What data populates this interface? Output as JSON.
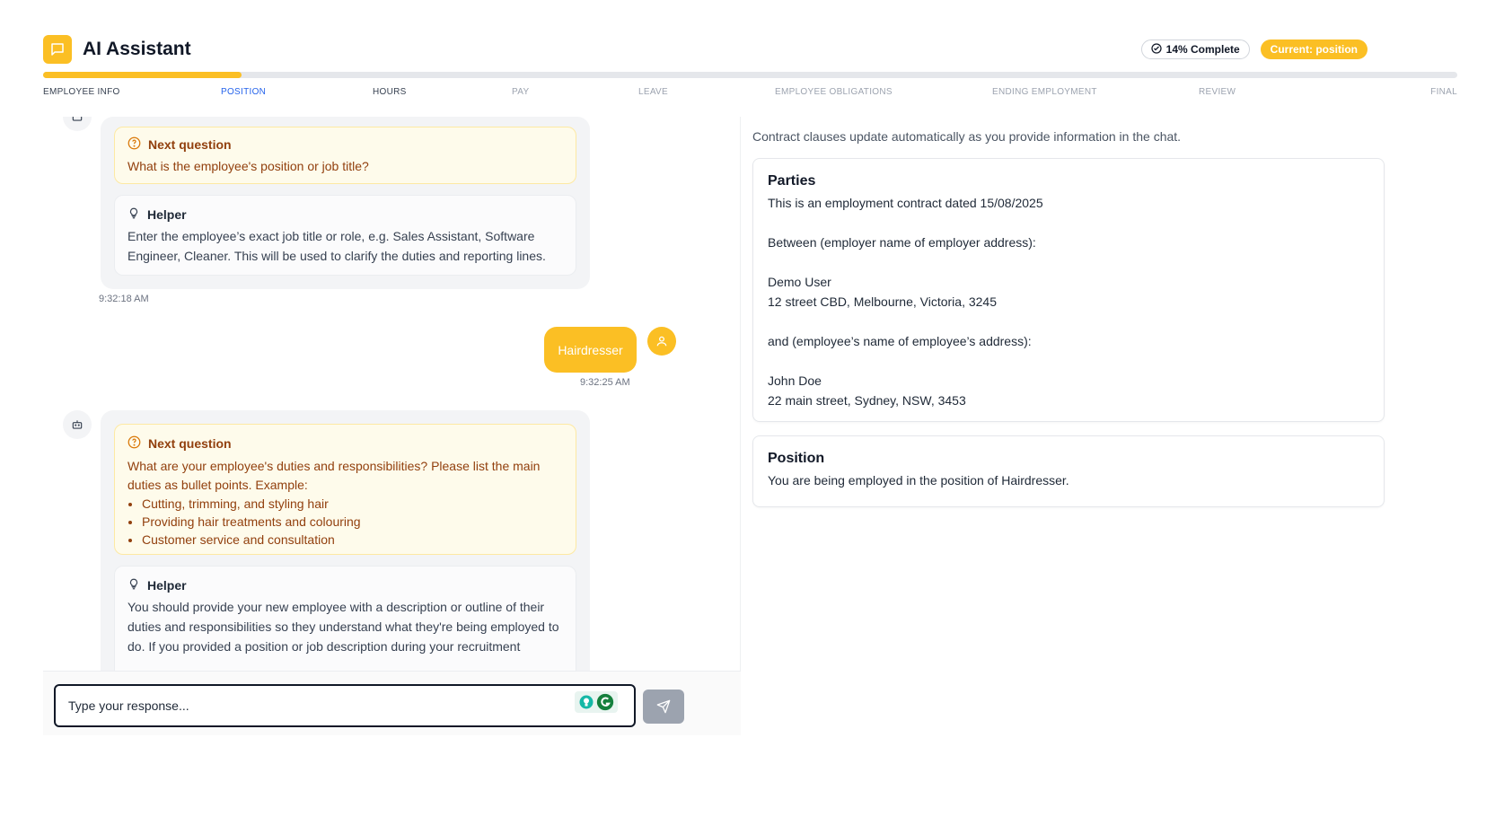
{
  "app": {
    "title": "AI Assistant",
    "completion": "14% Complete",
    "current": "Current: position",
    "progress_percent": 14,
    "accent_color": "#fbbf24"
  },
  "steps": [
    {
      "label": "EMPLOYEE INFO",
      "state": "done"
    },
    {
      "label": "POSITION",
      "state": "active"
    },
    {
      "label": "HOURS",
      "state": "done"
    },
    {
      "label": "PAY",
      "state": "todo"
    },
    {
      "label": "LEAVE",
      "state": "todo"
    },
    {
      "label": "EMPLOYEE OBLIGATIONS",
      "state": "todo"
    },
    {
      "label": "ENDING EMPLOYMENT",
      "state": "todo"
    },
    {
      "label": "REVIEW",
      "state": "todo"
    },
    {
      "label": "FINAL",
      "state": "todo"
    }
  ],
  "chat": {
    "msg1": {
      "question_heading": "Next question",
      "question_text": "What is the employee's position or job title?",
      "helper_heading": "Helper",
      "helper_text": "Enter the employee’s exact job title or role, e.g. Sales Assistant, Software Engineer, Cleaner. This will be used to clarify the duties and reporting lines.",
      "time": "9:32:18 AM"
    },
    "user_reply": {
      "text": "Hairdresser",
      "time": "9:32:25 AM"
    },
    "msg2": {
      "question_heading": "Next question",
      "question_text": "What are your employee's duties and responsibilities? Please list the main duties as bullet points. Example:",
      "bullets": [
        "Cutting, trimming, and styling hair",
        "Providing hair treatments and colouring",
        "Customer service and consultation"
      ],
      "helper_heading": "Helper",
      "helper_text": "You should provide your new employee with a description or outline of their duties and responsibilities so they understand what they're being employed to do. If you provided a position or job description during your recruitment"
    },
    "input_placeholder": "Type your response..."
  },
  "contract": {
    "note": "Contract clauses update automatically as you provide information in the chat.",
    "parties": {
      "title": "Parties",
      "lines": [
        "This is an employment contract dated 15/08/2025",
        "",
        "Between (employer name of employer address):",
        "",
        "Demo User",
        "12 street CBD, Melbourne, Victoria, 3245",
        "",
        "and (employee’s name of employee’s address):",
        "",
        "John Doe",
        "22 main street, Sydney, NSW, 3453"
      ]
    },
    "position": {
      "title": "Position",
      "text": "You are being employed in the position of Hairdresser."
    }
  }
}
